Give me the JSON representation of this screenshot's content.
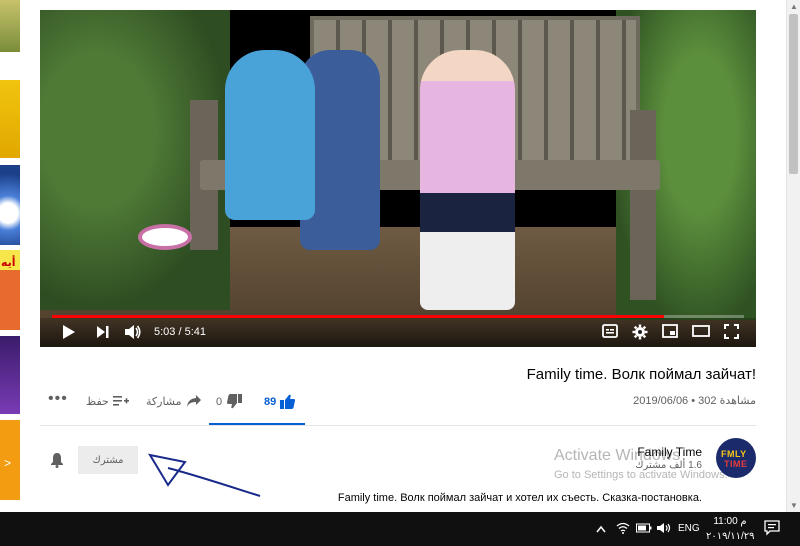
{
  "sidebar": {
    "thumb4_text": "أيه",
    "thumb6_text": ">"
  },
  "player": {
    "time": "5:03 / 5:41",
    "progress_fraction": 0.885
  },
  "video": {
    "title": "Family time. Волк поймал зайчат!",
    "views": "302 مشاهدة",
    "date": "2019/06/06",
    "separator": "•"
  },
  "actions": {
    "likes": "89",
    "dislikes": "0",
    "share_label": "مشاركة",
    "save_label": "حفظ"
  },
  "channel": {
    "name": "Family Time",
    "subscribers": "1.6 ألف مشترك",
    "subscribe_label": "مشترك",
    "avatar_line1": "FMLY",
    "avatar_line2": "TIME"
  },
  "description": "Family time. Волк поймал зайчат и хотел их съесть. Сказка-постановка.",
  "watermark": {
    "line1": "Activate Windows",
    "line2": "Go to Settings to activate Windows."
  },
  "taskbar": {
    "language": "ENG",
    "time": "11:00 م",
    "date": "٢٠١٩/١١/٢٩"
  },
  "colors": {
    "accent": "#065fd4",
    "progress": "#ff0000",
    "taskbar": "#101010"
  }
}
